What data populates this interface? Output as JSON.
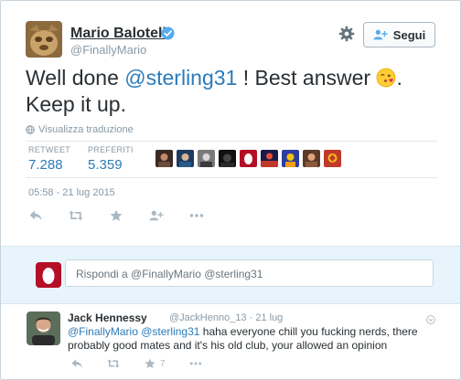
{
  "user": {
    "name": "Mario Balotelli",
    "handle": "@FinallyMario"
  },
  "header": {
    "follow_label": "Segui"
  },
  "tweet": {
    "text_before": "Well done ",
    "mention": "@sterling31",
    "text_after": " ! Best answer ",
    "text_end": ".",
    "line2": "Keep it up.",
    "translate_label": "Visualizza traduzione"
  },
  "stats": {
    "retweet_label": "RETWEET",
    "retweet_value": "7.288",
    "favorites_label": "PREFERITI",
    "favorites_value": "5.359"
  },
  "timestamp": "05:58 - 21 lug 2015",
  "reply_box": {
    "placeholder": "Rispondi a @FinallyMario @sterling31"
  },
  "reply": {
    "name": "Jack Hennessy",
    "meta": "@JackHenno_13 · 21 lug",
    "mention1": "@FinallyMario",
    "mention2": "@sterling31",
    "text": " haha everyone chill you fucking nerds, there probably good mates and it's his old club, your allowed an opinion",
    "favorite_count": "7"
  },
  "colors": {
    "link": "#2b7bb9",
    "muted": "#8899a6",
    "reply_bg": "#e8f4fb",
    "egg": "#b40f26"
  }
}
